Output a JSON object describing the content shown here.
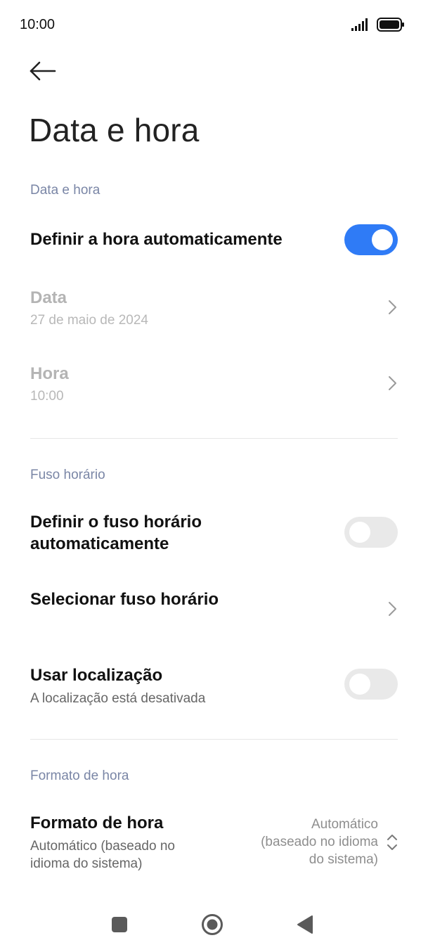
{
  "status_bar": {
    "time": "10:00",
    "signal_icon": "signal-icon",
    "battery_icon": "battery-icon"
  },
  "header": {
    "back_icon": "back-arrow-icon",
    "title": "Data e hora"
  },
  "sections": {
    "date_time": {
      "header": "Data e hora",
      "auto_time": {
        "label": "Definir a hora automaticamente",
        "enabled": true
      },
      "date": {
        "label": "Data",
        "value": "27 de maio de 2024"
      },
      "time": {
        "label": "Hora",
        "value": "10:00"
      }
    },
    "timezone": {
      "header": "Fuso horário",
      "auto_timezone": {
        "label_line1": "Definir o fuso horário",
        "label_line2": "automaticamente",
        "enabled": false
      },
      "select_timezone": {
        "label": "Selecionar fuso horário"
      },
      "use_location": {
        "label": "Usar localização",
        "sub": "A localização está desativada",
        "enabled": false
      }
    },
    "time_format": {
      "header": "Formato de hora",
      "format": {
        "label": "Formato de hora",
        "sub_line1": "Automático (baseado no",
        "sub_line2": "idioma do sistema)",
        "value_line1": "Automático",
        "value_line2": "(baseado no idioma",
        "value_line3": "do sistema)"
      }
    }
  },
  "nav_bar": {
    "recents_icon": "square-icon",
    "home_icon": "circle-home-icon",
    "back_icon": "triangle-back-icon"
  },
  "colors": {
    "accent": "#2f7bf6",
    "section_header": "#7a86a6",
    "toggle_off": "#e9e9e9"
  }
}
